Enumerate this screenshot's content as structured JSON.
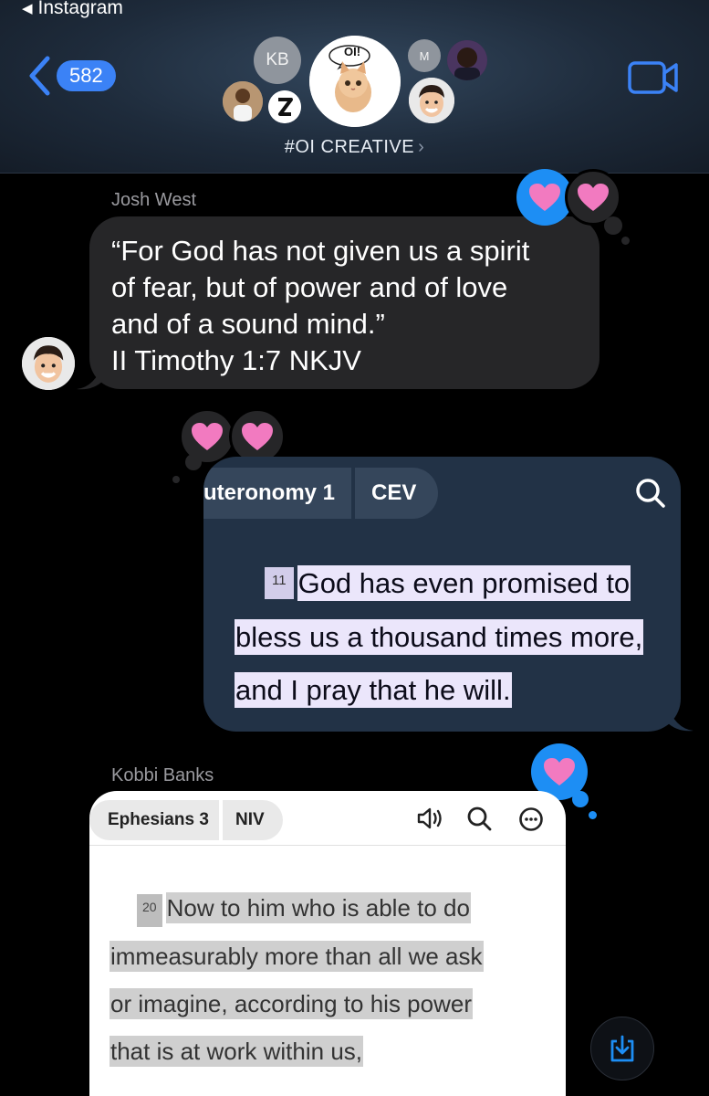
{
  "status_bar": {
    "back_app_label": "Instagram"
  },
  "header": {
    "unread_count": "582",
    "group_name": "#OI CREATIVE",
    "main_avatar_text": "OI!",
    "avatars": {
      "kb": "KB",
      "m": "M"
    }
  },
  "messages": [
    {
      "sender": "Josh West",
      "text_lines": [
        "“For God has not given us a spirit",
        "of fear, but of power and of love",
        "and of a sound mind.”",
        "II Timothy 1:7 NKJV"
      ],
      "reactions": [
        "pink-heart",
        "pink-heart"
      ]
    },
    {
      "outgoing": true,
      "book_tab": "uteronomy 1",
      "version_tab": "CEV",
      "verse_number": "11",
      "verse_lines": [
        "God has even promised to",
        "bless us a thousand times more,",
        "and I pray that he will."
      ],
      "reactions": [
        "pink-heart",
        "pink-heart"
      ]
    },
    {
      "sender": "Kobbi Banks",
      "book_tab": "Ephesians 3",
      "version_tab": "NIV",
      "verse_number": "20",
      "verse_lines": [
        "Now to him who is able to do",
        "immeasurably more than all we ask",
        "or imagine, according to his power",
        "that is at work within us,"
      ],
      "reactions": [
        "pink-heart"
      ]
    }
  ],
  "colors": {
    "accent_blue": "#1d8ef4",
    "bubble_incoming": "#262628",
    "bubble_outgoing": "#223246",
    "heart_pink": "#f27ac0"
  }
}
